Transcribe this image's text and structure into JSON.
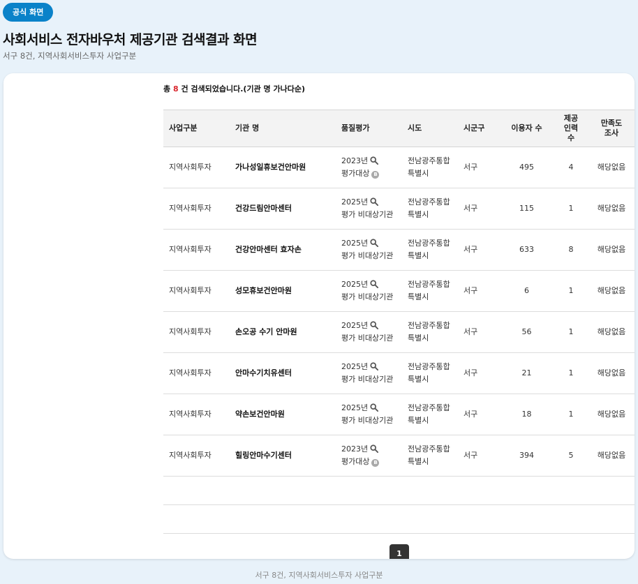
{
  "badge": "공식 화면",
  "title": "사회서비스 전자바우처 제공기관 검색결과 화면",
  "subtitle": "서구 8건, 지역사회서비스투자 사업구분",
  "summary": {
    "prefix": "총",
    "count": "8",
    "suffix": "건 검색되었습니다.(기관 명 가나다순)"
  },
  "table": {
    "headers": {
      "program": "사업구분",
      "org": "기관 명",
      "quality": "품질평가",
      "city": "시도",
      "district": "시군구",
      "users": "이용자 수",
      "staff_line1": "제공",
      "staff_line2": "인력 수",
      "survey_line1": "만족도",
      "survey_line2": "조사"
    },
    "rows": [
      {
        "program": "지역사회투자",
        "org": "가나성일휴보건안마원",
        "year": "2023년",
        "status": "평가대상",
        "grade": "B",
        "city_line1": "전남광주통합",
        "city_line2": "특별시",
        "district": "서구",
        "users": "495",
        "staff": "4",
        "survey": "해당없음"
      },
      {
        "program": "지역사회투자",
        "org": "건강드림안마센터",
        "year": "2025년",
        "status": "평가 비대상기관",
        "grade": "",
        "city_line1": "전남광주통합",
        "city_line2": "특별시",
        "district": "서구",
        "users": "115",
        "staff": "1",
        "survey": "해당없음"
      },
      {
        "program": "지역사회투자",
        "org": "건강안마센터 효자손",
        "year": "2025년",
        "status": "평가 비대상기관",
        "grade": "",
        "city_line1": "전남광주통합",
        "city_line2": "특별시",
        "district": "서구",
        "users": "633",
        "staff": "8",
        "survey": "해당없음"
      },
      {
        "program": "지역사회투자",
        "org": "성모휴보건안마원",
        "year": "2025년",
        "status": "평가 비대상기관",
        "grade": "",
        "city_line1": "전남광주통합",
        "city_line2": "특별시",
        "district": "서구",
        "users": "6",
        "staff": "1",
        "survey": "해당없음"
      },
      {
        "program": "지역사회투자",
        "org": "손오공 수기 안마원",
        "year": "2025년",
        "status": "평가 비대상기관",
        "grade": "",
        "city_line1": "전남광주통합",
        "city_line2": "특별시",
        "district": "서구",
        "users": "56",
        "staff": "1",
        "survey": "해당없음"
      },
      {
        "program": "지역사회투자",
        "org": "안마수기치유센터",
        "year": "2025년",
        "status": "평가 비대상기관",
        "grade": "",
        "city_line1": "전남광주통합",
        "city_line2": "특별시",
        "district": "서구",
        "users": "21",
        "staff": "1",
        "survey": "해당없음"
      },
      {
        "program": "지역사회투자",
        "org": "약손보건안마원",
        "year": "2025년",
        "status": "평가 비대상기관",
        "grade": "",
        "city_line1": "전남광주통합",
        "city_line2": "특별시",
        "district": "서구",
        "users": "18",
        "staff": "1",
        "survey": "해당없음"
      },
      {
        "program": "지역사회투자",
        "org": "힐링안마수기센터",
        "year": "2023년",
        "status": "평가대상",
        "grade": "B",
        "city_line1": "전남광주통합",
        "city_line2": "특별시",
        "district": "서구",
        "users": "394",
        "staff": "5",
        "survey": "해당없음"
      }
    ]
  },
  "pagination": {
    "current": "1"
  },
  "footer": "서구 8건, 지역사회서비스투자 사업구분",
  "colors": {
    "accent": "#0a82c9",
    "count": "#d9272e",
    "background": "#e8f2fa"
  },
  "icons": {
    "quality_lookup": "search-icon",
    "grade": "grade-badge"
  }
}
